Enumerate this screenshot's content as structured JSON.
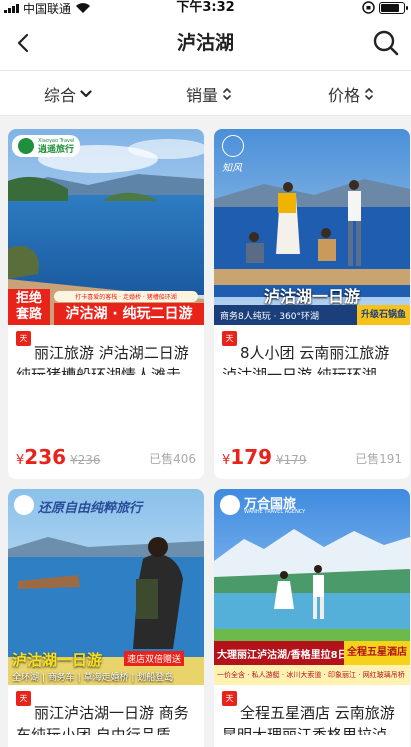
{
  "status_bar": {
    "carrier": "中国联通",
    "time": "下午3:32",
    "battery_level": 0.8
  },
  "nav": {
    "title": "泸沽湖"
  },
  "sort_bar": {
    "items": [
      {
        "label": "综合",
        "icon": "chevron-down-icon"
      },
      {
        "label": "销量",
        "icon": "sort-updown-icon"
      },
      {
        "label": "价格",
        "icon": "sort-updown-icon"
      }
    ]
  },
  "products": [
    {
      "title": "丽江旅游 泸沽湖二日游 纯玩猪槽船环湖情人滩走…",
      "price_symbol": "¥",
      "price": "236",
      "original_price": "¥236",
      "sold": "已售406",
      "badge": "天猫",
      "image": {
        "brand": "逍遥旅行",
        "brand_sub": "Xiaoyao Travel",
        "tag": "拒绝套路",
        "subtitle": "打卡喜爱的客栈 · 走婚桥 · 猪槽船环湖",
        "headline": "泸沽湖 · 纯玩二日游"
      }
    },
    {
      "title": "8人小团 云南丽江旅游 泸沽湖一日游 纯玩环湖…",
      "price_symbol": "¥",
      "price": "179",
      "original_price": "¥179",
      "sold": "已售191",
      "badge": "天猫",
      "image": {
        "brand": "知风",
        "headline": "泸沽湖一日游",
        "subtitle": "商务8人纯玩 · 360°环湖",
        "tag": "升级石锅鱼"
      }
    },
    {
      "title": "丽江泸沽湖一日游 商务车纯玩小团 自由行品质…",
      "badge": "天猫",
      "image": {
        "brand": "还原自由纯粹旅行",
        "headline": "泸沽湖一日游",
        "tag": "速店双倍赠送",
        "subtitle": "全环湖 | 商务车 | 草海走婚桥 | 划船登岛"
      }
    },
    {
      "title": "全程五星酒店 云南旅游 昆明大理丽江香格里拉泸…",
      "badge": "天猫",
      "image": {
        "brand": "万合国旅",
        "brand_sub": "WANHE TRAVEL AGENCY",
        "headline": "大理丽江泸沽湖/香格里拉8日",
        "tag": "全程五星酒店",
        "subtitle": "一价全含 · 私人游艇 · 冰川大索道 · 印象丽江 · 网红玻璃吊桥"
      }
    }
  ]
}
